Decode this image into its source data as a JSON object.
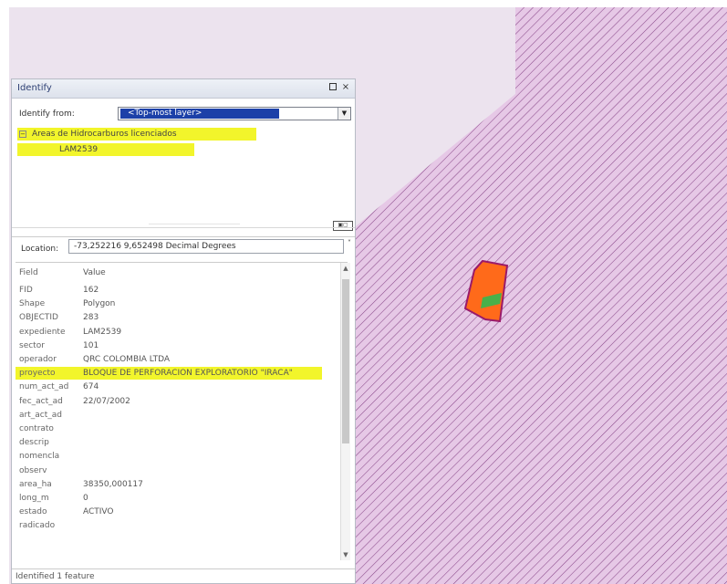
{
  "window": {
    "title": "Identify",
    "restore_icon": "restore-icon",
    "close_icon": "close-icon",
    "close_glyph": "×"
  },
  "identify_from": {
    "label": "Identify from:",
    "value": "<Top-most layer>"
  },
  "tree": {
    "layer_name": "Areas de Hidrocarburos licenciados",
    "feature_name": "LAM2539",
    "toggle_glyph": "−"
  },
  "location": {
    "label": "Location:",
    "value": "-73,252216  9,652498 Decimal Degrees"
  },
  "attributes": {
    "headers": {
      "field": "Field",
      "value": "Value"
    },
    "rows": [
      {
        "field": "FID",
        "value": "162"
      },
      {
        "field": "Shape",
        "value": "Polygon"
      },
      {
        "field": "OBJECTID",
        "value": "283"
      },
      {
        "field": "expediente",
        "value": "LAM2539"
      },
      {
        "field": "sector",
        "value": "101"
      },
      {
        "field": "operador",
        "value": "QRC COLOMBIA LTDA"
      },
      {
        "field": "proyecto",
        "value": "BLOQUE DE PERFORACION EXPLORATORIO \"IRACA\""
      },
      {
        "field": "num_act_ad",
        "value": "674"
      },
      {
        "field": "fec_act_ad",
        "value": "22/07/2002"
      },
      {
        "field": "art_act_ad",
        "value": ""
      },
      {
        "field": "contrato",
        "value": ""
      },
      {
        "field": "descrip",
        "value": ""
      },
      {
        "field": "nomencla",
        "value": ""
      },
      {
        "field": "observ",
        "value": ""
      },
      {
        "field": "area_ha",
        "value": "38350,000117"
      },
      {
        "field": "long_m",
        "value": "0"
      },
      {
        "field": "estado",
        "value": "ACTIVO"
      },
      {
        "field": "radicado",
        "value": ""
      }
    ]
  },
  "status": {
    "text": "Identified 1 feature"
  },
  "colors": {
    "highlight": "#f2f52b",
    "map_background": "#ece3ee",
    "hatch_fill": "#e6c8e6",
    "hatch_line": "#8a4a8a",
    "feature_fill": "#ff6a1a",
    "feature_outline": "#9a1a6a",
    "selection_blue": "#1c40a8"
  }
}
